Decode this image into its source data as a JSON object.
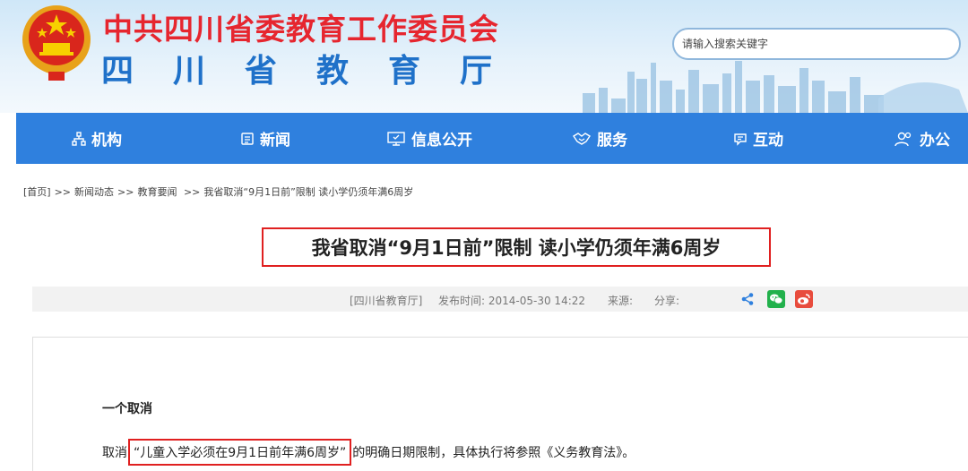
{
  "header": {
    "org_title": "中共四川省委教育工作委员会",
    "dept_title": "四川省教育厅",
    "emblem_icon": "national-emblem-icon"
  },
  "search": {
    "placeholder": "请输入搜索关键字"
  },
  "nav": {
    "items": [
      {
        "label": "机构",
        "icon": "org-chart-icon"
      },
      {
        "label": "新闻",
        "icon": "newspaper-icon"
      },
      {
        "label": "信息公开",
        "icon": "monitor-icon"
      },
      {
        "label": "服务",
        "icon": "handshake-icon"
      },
      {
        "label": "互动",
        "icon": "chat-icon"
      },
      {
        "label": "办公",
        "icon": "people-icon"
      }
    ]
  },
  "breadcrumb": {
    "home": "[首页]",
    "sep": ">>",
    "level1": "新闻动态",
    "level2": "教育要闻",
    "current": "我省取消“9月1日前”限制 读小学仍须年满6周岁"
  },
  "article": {
    "title": "我省取消“9月1日前”限制 读小学仍须年满6周岁",
    "source": "[四川省教育厅]",
    "publish_label": "发布时间:",
    "publish_time": "2014-05-30 14:22",
    "origin_label": "来源:",
    "share_label": "分享:",
    "share_icons": [
      "share-icon",
      "wechat-icon",
      "weibo-icon"
    ],
    "section_heading": "一个取消",
    "para_prefix": "取消",
    "para_quote": "“儿童入学必须在9月1日前年满6周岁”",
    "para_suffix": "的明确日期限制，具体执行将参照《义务教育法》。"
  },
  "colors": {
    "nav_bg": "#2f80de",
    "org_title": "#e6262f",
    "dept_title": "#1f71c9",
    "highlight_border": "#e02020"
  }
}
